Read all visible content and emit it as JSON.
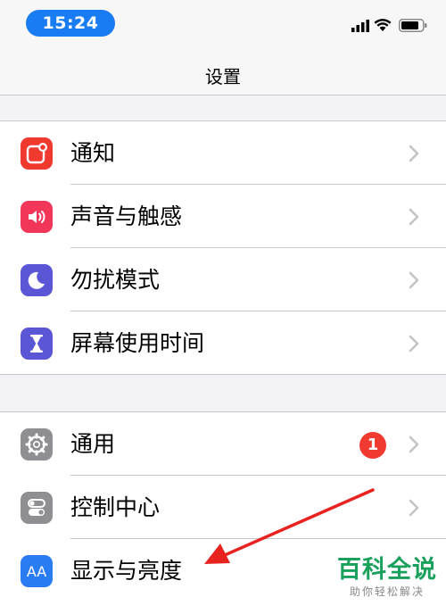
{
  "status_bar": {
    "time": "15:24",
    "icons": [
      "cellular-signal-icon",
      "wifi-icon",
      "battery-icon"
    ]
  },
  "nav": {
    "title": "设置"
  },
  "groups": [
    {
      "items": [
        {
          "label": "通知",
          "icon": "notifications-icon",
          "color": "#f0392f"
        },
        {
          "label": "声音与触感",
          "icon": "speaker-icon",
          "color": "#f2365a"
        },
        {
          "label": "勿扰模式",
          "icon": "moon-icon",
          "color": "#5b56d6"
        },
        {
          "label": "屏幕使用时间",
          "icon": "hourglass-icon",
          "color": "#5b56d6"
        }
      ]
    },
    {
      "items": [
        {
          "label": "通用",
          "icon": "gear-icon",
          "color": "#8e8e93",
          "badge": "1"
        },
        {
          "label": "控制中心",
          "icon": "toggles-icon",
          "color": "#8e8e93"
        },
        {
          "label": "显示与亮度",
          "icon": "text-size-icon",
          "color": "#2a7cf2",
          "icon_text": "AA"
        }
      ]
    }
  ],
  "watermark": {
    "title": "百科全说",
    "subtitle": "助你轻松解决"
  },
  "colors": {
    "accent": "#1a7cf2",
    "badge": "#f0392f",
    "arrow": "#e8231f",
    "watermark": "#19a05c"
  }
}
